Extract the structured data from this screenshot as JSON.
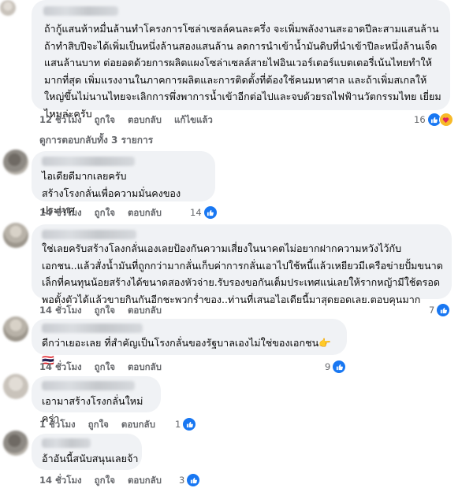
{
  "comments": [
    {
      "text": "ถ้ากู้แสนห้าหมื่นล้านทำโครงการโซล่าเซลล์คนละครึ่ง จะเพิ่มพลังงานสะอาดปีละสามแสนล้าน ถ้าทำสิบปีจะได้เพิ่มเป็นหนึ่งล้านสองแสนล้าน ลดการนำเข้าน้ำมันดิบที่นำเข้าปีละหนึ่งล้านเจ็ดแสนล้านบาท ต่อยอดด้วยการผลิตแผงโซล่าเซลล์สายไฟอินเวอร์เตอร์แบตเตอรี่เน้นไทยทำให้มากที่สุด เพิ่มแรงงานในภาคการผลิตและการติดตั้งที่ต้องใช้คนมหาศาล และถ้าเพิ่มสเกลให้ใหญ่ขึ้นไม่นานไทยจะเลิกการพึ่งพาการน้ำเข้าอีกต่อไปและจบด้วยรถไฟฟ้านวัตกรรมไทย เยี่ยมไหมล่ะครับ",
      "time": "12 ชั่วโมง",
      "actions": [
        "ถูกใจ",
        "ตอบกลับ",
        "แก้ไขแล้ว"
      ],
      "reactions": "16"
    },
    {
      "text": "ไอเดียดีมากเลยครับ\nสร้างโรงกลั่นเพื่อความมั่นคงของประเทศ",
      "time": "14 ชั่วโมง",
      "actions": [
        "ถูกใจ",
        "ตอบกลับ"
      ],
      "reactions": "14"
    },
    {
      "text": "ใช่เลยครับสร้างโลงกลั่นเองเลยป้องกันความเสี่ยงในนาคตไม่อยากฝากความหวังไว้กับเอกชน..แล้วสั่งน้ำมันที่ถูกกว่ามากลั่นเก็บค่าการกลั่นเอาไปใช้หนี้แล้วเหยียวมีเครือข่ายปั้มขนาดเล็กที่คนทุนน้อยสร้างได้ขนาดสองหัวจ่าย.รับรองขอกันเต็มประเทศแน่เลยให้รากหญ้ามีใช้ตรอดพอตั้งตัวได้แล้วขายกินกันอีกชะพวกร่ำของ..ท่านที่เสนอไอเดียนี้มาสุดยอดเลย.ตอบคุนมาก",
      "time": "14 ชั่วโมง",
      "actions": [
        "ถูกใจ",
        "ตอบกลับ"
      ],
      "reactions": "7"
    },
    {
      "text": "ดีกว่าเยอะเลย ที่สำคัญเป็นโรงกลั่นของรัฐบาลเองไม่ใช่ของเอกชน👉🇹🇭",
      "time": "14 ชั่วโมง",
      "actions": [
        "ถูกใจ",
        "ตอบกลับ"
      ],
      "reactions": "9"
    },
    {
      "text": "เอามาสร้างโรงกลั่นใหม่คร่า",
      "time": "1 ชั่วโมง",
      "actions": [
        "ถูกใจ",
        "ตอบกลับ"
      ],
      "reactions": "1"
    },
    {
      "text": "อ้าอันนี้สนับสนุนเลยจ้า",
      "time": "14 ชั่วโมง",
      "actions": [
        "ถูกใจ",
        "ตอบกลับ"
      ],
      "reactions": "3"
    }
  ],
  "view_replies": "ดูการตอบกลับทั้ง 3 รายการ",
  "colors": {
    "like": "#1877f2",
    "bubble": "#f0f2f5",
    "meta": "#65676b"
  },
  "icons": {
    "like": "thumbs-up-icon",
    "love": "love-care-icon"
  }
}
